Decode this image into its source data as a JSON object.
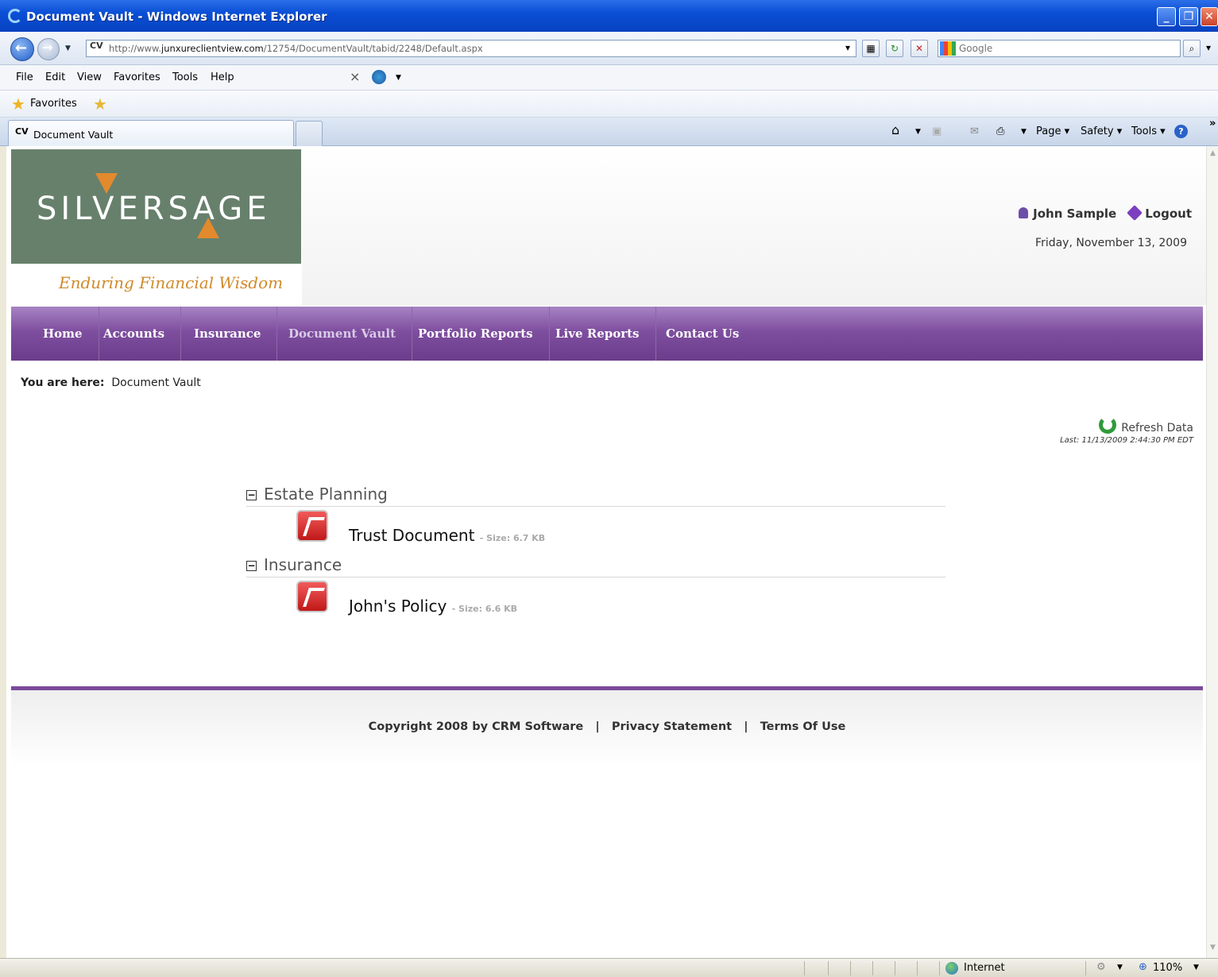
{
  "window": {
    "title": "Document Vault - Windows Internet Explorer",
    "minimize": "_",
    "restore": "❐",
    "close": "✕"
  },
  "address": {
    "site_badge": "CV",
    "url_prefix": "http://www.",
    "url_domain": "junxureclientview.com",
    "url_path": "/12754/DocumentVault/tabid/2248/Default.aspx"
  },
  "search": {
    "placeholder": "Google"
  },
  "menu": [
    "File",
    "Edit",
    "View",
    "Favorites",
    "Tools",
    "Help"
  ],
  "favorites": {
    "label": "Favorites"
  },
  "tab": {
    "title": "Document Vault",
    "badge": "CV"
  },
  "commandbar": {
    "page": "Page ▾",
    "safety": "Safety ▾",
    "tools": "Tools ▾",
    "help": "?",
    "overflow": "»"
  },
  "site": {
    "brand": "SILVERSAGE",
    "tagline": "Enduring Financial Wisdom",
    "user_name": "John Sample",
    "logout_label": "Logout",
    "date": "Friday, November 13, 2009"
  },
  "nav": [
    "Home",
    "Accounts",
    "Insurance",
    "Document Vault",
    "Portfolio Reports",
    "Live Reports",
    "Contact Us"
  ],
  "nav_active": "Document Vault",
  "breadcrumb": {
    "prefix": "You are here:",
    "current": "Document Vault"
  },
  "refresh": {
    "label": "Refresh Data",
    "last": "Last: 11/13/2009 2:44:30 PM EDT"
  },
  "folders": [
    {
      "name": "Estate Planning",
      "toggle": "−",
      "documents": [
        {
          "name": "Trust Document",
          "size": "- Size: 6.7 KB"
        }
      ]
    },
    {
      "name": "Insurance",
      "toggle": "−",
      "documents": [
        {
          "name": "John's Policy",
          "size": "- Size: 6.6 KB"
        }
      ]
    }
  ],
  "footer": {
    "copyright": "Copyright 2008 by CRM Software",
    "privacy": "Privacy Statement",
    "terms": "Terms Of Use",
    "separator": "|"
  },
  "status": {
    "zone": "Internet",
    "zoom": "110%"
  },
  "colors": {
    "nav_purple": "#7f4f9f",
    "logo_green": "#67806c",
    "accent_orange": "#e28a2d"
  }
}
